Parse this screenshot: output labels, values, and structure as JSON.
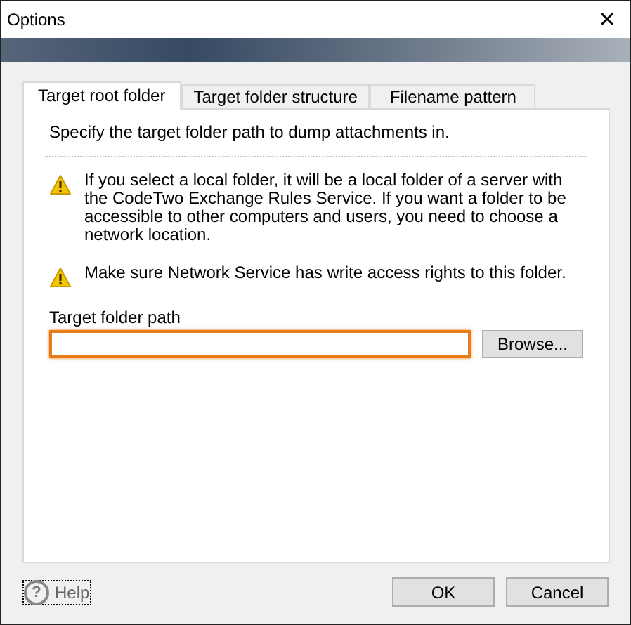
{
  "window": {
    "title": "Options",
    "close": "✕"
  },
  "tabs": [
    {
      "label": "Target root folder",
      "selected": true
    },
    {
      "label": "Target folder structure",
      "selected": false
    },
    {
      "label": "Filename pattern",
      "selected": false
    }
  ],
  "description": "Specify the target folder path to dump attachments in.",
  "warnings": [
    "If you select a local folder, it will be a local folder of a server with the CodeTwo Exchange Rules Service. If you want a folder to be accessible to other computers and users, you need to choose a network location.",
    "Make sure Network Service has write access rights to this folder."
  ],
  "path_field": {
    "label": "Target folder path",
    "focused": true,
    "browse": "Browse..."
  },
  "help": {
    "icon": "?",
    "label": "Help"
  },
  "buttons": [
    "OK",
    "Cancel"
  ]
}
